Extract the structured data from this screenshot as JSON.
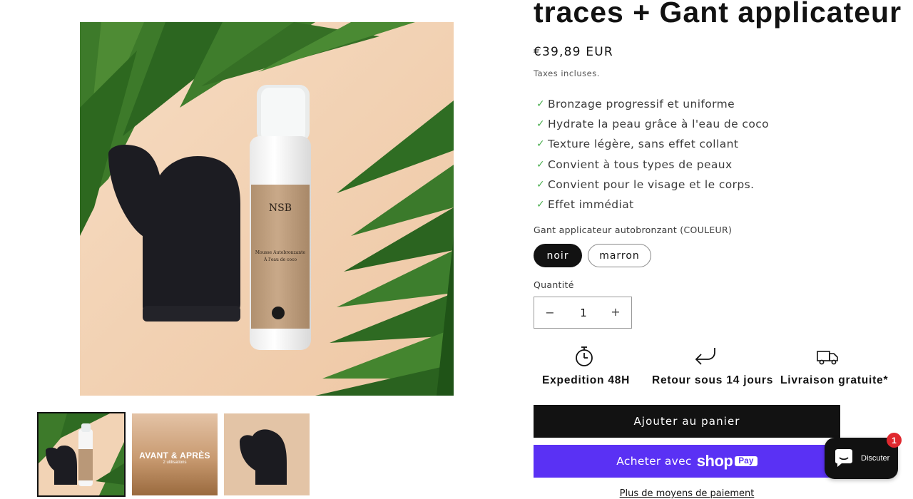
{
  "product": {
    "title": "traces + Gant applicateur",
    "price": "€39,89 EUR",
    "tax_note": "Taxes incluses.",
    "features": [
      "Bronzage progressif et uniforme",
      "Hydrate la peau grâce à l'eau de coco",
      "Texture légère, sans effet collant",
      "Convient à tous types de peaux",
      "Convient pour le visage et le corps.",
      "Effet immédiat"
    ],
    "image_text": {
      "brand": "NSB",
      "label_line1": "Mousse Autobronzante",
      "label_line2": "À l'eau de coco"
    }
  },
  "thumbnails": [
    {
      "caption": "",
      "sub": "",
      "selected": true
    },
    {
      "caption": "AVANT & APRÈS",
      "sub": "2 utilisations",
      "selected": false
    },
    {
      "caption": "",
      "sub": "",
      "selected": false
    }
  ],
  "variant": {
    "label": "Gant applicateur autobronzant (COULEUR)",
    "options": [
      "noir",
      "marron"
    ],
    "selected": "noir"
  },
  "quantity": {
    "label": "Quantité",
    "value": "1",
    "minus": "−",
    "plus": "+"
  },
  "perks": [
    {
      "icon": "stopwatch-icon",
      "label": "Expedition 48H"
    },
    {
      "icon": "return-arrow-icon",
      "label": "Retour sous 14 jours"
    },
    {
      "icon": "truck-icon",
      "label": "Livraison gratuite*"
    }
  ],
  "buttons": {
    "add_to_cart": "Ajouter au panier",
    "buy_with": "Acheter avec",
    "shop_word": "shop",
    "pay_badge": "Pay",
    "more_payment": "Plus de moyens de paiement"
  },
  "chat": {
    "label": "Discuter",
    "badge": "1"
  },
  "colors": {
    "primary": "#121212",
    "shop_pay": "#5a31f4",
    "check": "#4caf50",
    "badge": "#e0282e"
  }
}
